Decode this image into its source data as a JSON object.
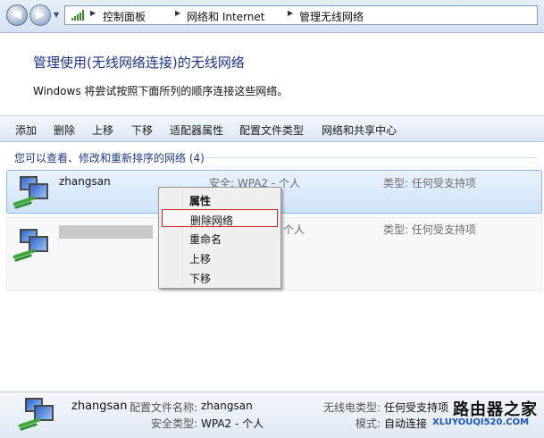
{
  "breadcrumb": [
    "控制面板",
    "网络和 Internet",
    "管理无线网络"
  ],
  "header": {
    "title": "管理使用(无线网络连接)的无线网络",
    "description": "Windows 将尝试按照下面所列的顺序连接这些网络。"
  },
  "toolbar": [
    "添加",
    "删除",
    "上移",
    "下移",
    "适配器属性",
    "配置文件类型",
    "网络和共享中心"
  ],
  "section_title": "您可以查看、修改和重新排序的网络 (4)",
  "networks": [
    {
      "name": "zhangsan",
      "security": "安全: WPA2 - 个人",
      "type": "类型: 任何受支持项"
    },
    {
      "name": "",
      "security": "个人",
      "type": "类型: 任何受支持项"
    }
  ],
  "context_menu": [
    "属性",
    "删除网络",
    "重命名",
    "上移",
    "下移"
  ],
  "details": {
    "name": "zhangsan",
    "profile_label": "配置文件名称:",
    "profile_value": "zhangsan",
    "security_label": "安全类型:",
    "security_value": "WPA2 - 个人",
    "radio_label": "无线电类型:",
    "radio_value": "任何受支持项",
    "mode_label": "模式:",
    "mode_value": "自动连接"
  },
  "watermark": {
    "cn": "路由器之家",
    "url": "XLUYOUQI520.COM"
  },
  "icons": {
    "back": "back-arrow-icon",
    "forward": "forward-arrow-icon",
    "signal": "signal-bars-icon",
    "computer": "network-computer-icon"
  }
}
